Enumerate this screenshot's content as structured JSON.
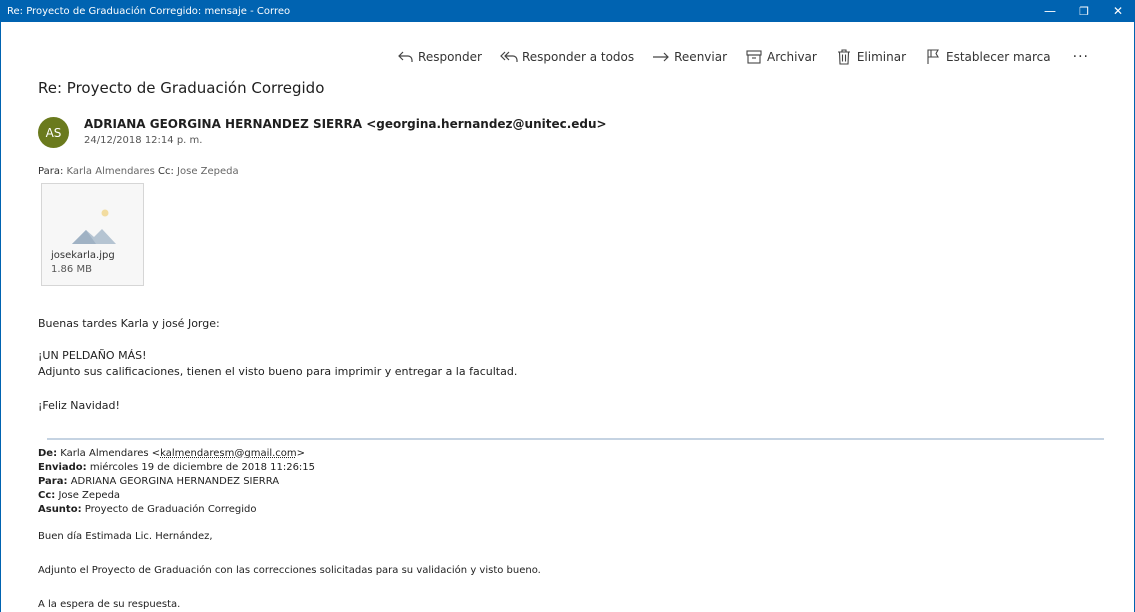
{
  "window": {
    "title": "Re: Proyecto de Graduación Corregido: mensaje - Correo",
    "controls": {
      "minimize": "—",
      "restore": "❐",
      "close": "✕"
    }
  },
  "toolbar": {
    "reply": "Responder",
    "reply_all": "Responder a todos",
    "forward": "Reenviar",
    "archive": "Archivar",
    "delete": "Eliminar",
    "flag": "Establecer marca",
    "more": "···"
  },
  "message": {
    "subject": "Re: Proyecto de Graduación Corregido",
    "avatar_initials": "AS",
    "avatar_color": "#6a7a1d",
    "sender": "ADRIANA GEORGINA HERNANDEZ SIERRA <georgina.hernandez@unitec.edu>",
    "date": "24/12/2018 12:14 p. m.",
    "to_label": "Para:",
    "to": "Karla Almendares",
    "cc_label": "Cc:",
    "cc": "Jose Zepeda"
  },
  "attachment": {
    "filename": "josekarla.jpg",
    "size": "1.86 MB"
  },
  "body": {
    "greeting": "Buenas tardes Karla y josé Jorge:",
    "line1": "¡UN PELDAÑO MÁS!",
    "line2": "Adjunto sus calificaciones, tienen el visto bueno para imprimir y entregar a la facultad.",
    "closing": "¡Feliz Navidad!"
  },
  "original": {
    "from_label": "De:",
    "from_name": "Karla Almendares <",
    "from_email": "kalmendaresm@gmail.com",
    "from_end": ">",
    "sent_label": "Enviado:",
    "sent": "miércoles 19 de diciembre de 2018 11:26:15",
    "to_label": "Para:",
    "to": "ADRIANA GEORGINA HERNANDEZ SIERRA",
    "cc_label": "Cc:",
    "cc": "Jose Zepeda",
    "subject_label": "Asunto:",
    "subject": "Proyecto de Graduación Corregido",
    "greeting": "Buen día Estimada Lic. Hernández,",
    "line1": "Adjunto el Proyecto de Graduación con las correcciones solicitadas para su validación y visto bueno.",
    "line2": "A la espera de su respuesta."
  },
  "colors": {
    "titlebar": "#0063b1",
    "divider": "#c5d3e2"
  }
}
